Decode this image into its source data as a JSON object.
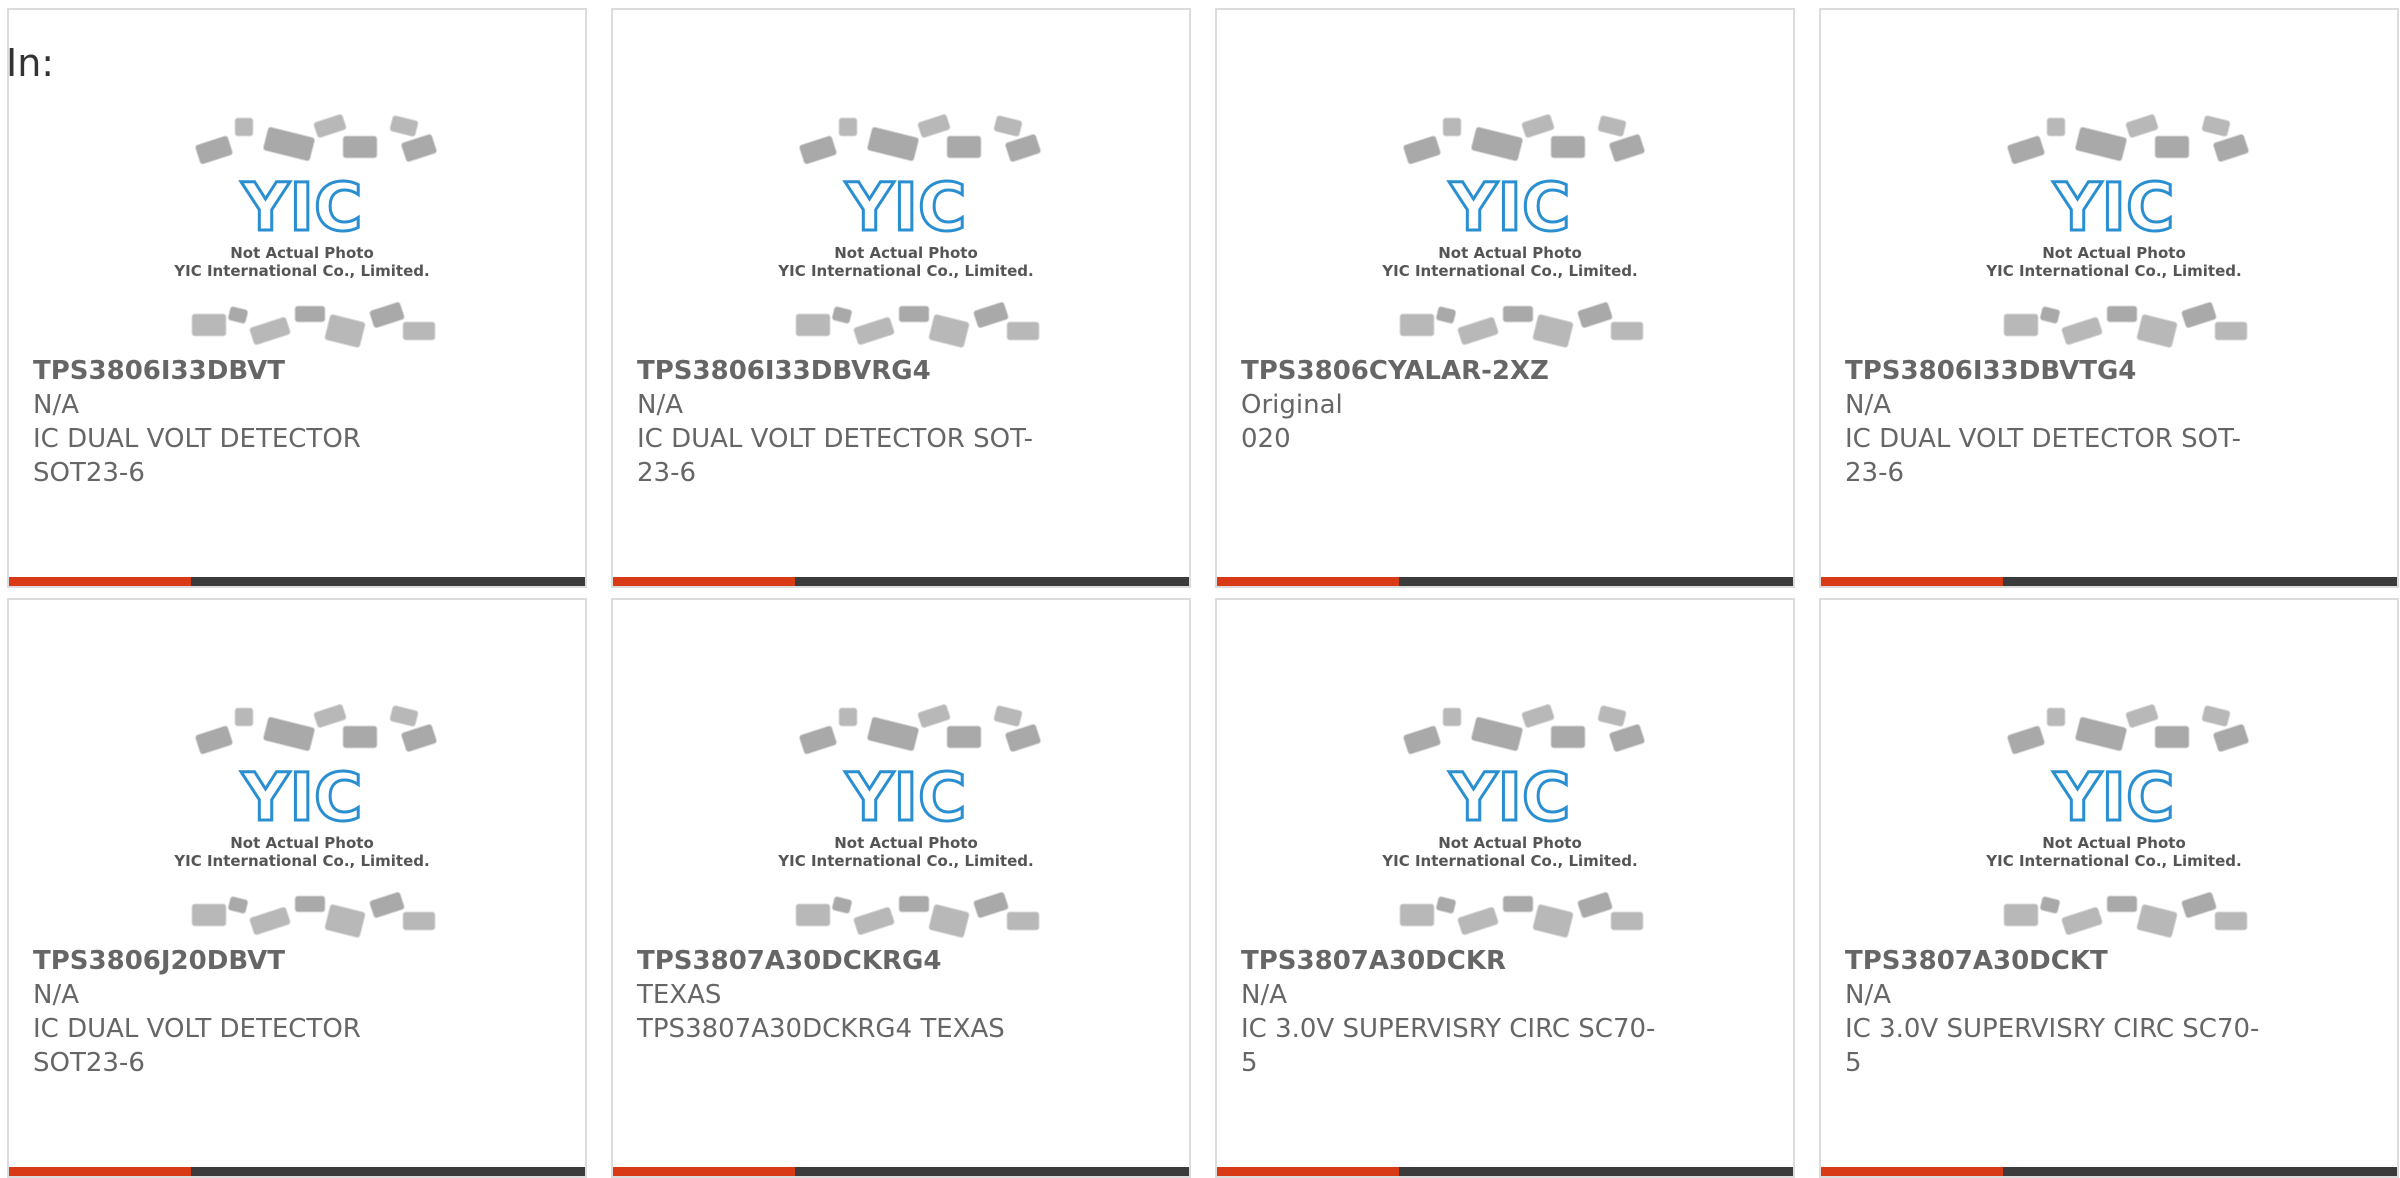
{
  "in_label": "In:",
  "placeholder_image": {
    "caption_line1": "Not Actual Photo",
    "caption_line2": "YIC International Co., Limited.",
    "logo_text": "YIC",
    "logo_color": "#2a8fd0"
  },
  "colors": {
    "accent": "#d93a16",
    "bar": "#3b3b3b",
    "border": "#dcdcdc",
    "text": "#666666"
  },
  "products": [
    {
      "part": "TPS3806I33DBVT",
      "manufacturer": "N/A",
      "desc_lines": [
        "IC DUAL VOLT DETECTOR",
        "SOT23-6"
      ]
    },
    {
      "part": "TPS3806I33DBVRG4",
      "manufacturer": "N/A",
      "desc_lines": [
        "IC DUAL VOLT DETECTOR SOT-",
        "23-6"
      ]
    },
    {
      "part": "TPS3806CYALAR-2XZ",
      "manufacturer": "Original",
      "desc_lines": [
        "020"
      ]
    },
    {
      "part": "TPS3806I33DBVTG4",
      "manufacturer": "N/A",
      "desc_lines": [
        "IC DUAL VOLT DETECTOR SOT-",
        "23-6"
      ]
    },
    {
      "part": "TPS3806J20DBVT",
      "manufacturer": "N/A",
      "desc_lines": [
        "IC DUAL VOLT DETECTOR",
        "SOT23-6"
      ]
    },
    {
      "part": "TPS3807A30DCKRG4",
      "manufacturer": "TEXAS",
      "desc_lines": [
        "TPS3807A30DCKRG4 TEXAS"
      ]
    },
    {
      "part": "TPS3807A30DCKR",
      "manufacturer": "N/A",
      "desc_lines": [
        "IC 3.0V SUPERVISRY CIRC SC70-",
        "5"
      ]
    },
    {
      "part": "TPS3807A30DCKT",
      "manufacturer": "N/A",
      "desc_lines": [
        "IC 3.0V SUPERVISRY CIRC SC70-",
        "5"
      ]
    }
  ]
}
